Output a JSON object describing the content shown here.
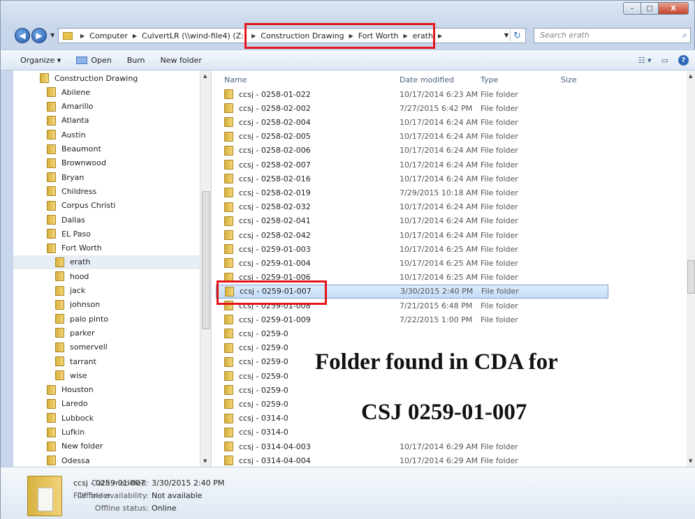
{
  "window": {
    "buttons": {
      "minimize": "–",
      "maximize": "□",
      "close": "X"
    }
  },
  "address": {
    "crumbs": [
      "Computer",
      "CulvertLR (\\\\wind-file4) (Z:)",
      "Construction Drawing",
      "Fort Worth",
      "erath"
    ],
    "search_placeholder": "Search erath"
  },
  "toolbar": {
    "organize": "Organize ▾",
    "open": "Open",
    "burn": "Burn",
    "new_folder": "New folder"
  },
  "nav": {
    "items": [
      {
        "label": "Construction Drawing",
        "level": 0
      },
      {
        "label": "Abilene",
        "level": 1
      },
      {
        "label": "Amarillo",
        "level": 1
      },
      {
        "label": "Atlanta",
        "level": 1
      },
      {
        "label": "Austin",
        "level": 1
      },
      {
        "label": "Beaumont",
        "level": 1
      },
      {
        "label": "Brownwood",
        "level": 1
      },
      {
        "label": "Bryan",
        "level": 1
      },
      {
        "label": "Childress",
        "level": 1
      },
      {
        "label": "Corpus Christi",
        "level": 1
      },
      {
        "label": "Dallas",
        "level": 1
      },
      {
        "label": "EL Paso",
        "level": 1
      },
      {
        "label": "Fort Worth",
        "level": 1
      },
      {
        "label": "erath",
        "level": 2,
        "selected": true
      },
      {
        "label": "hood",
        "level": 2
      },
      {
        "label": "jack",
        "level": 2
      },
      {
        "label": "johnson",
        "level": 2
      },
      {
        "label": "palo pinto",
        "level": 2
      },
      {
        "label": "parker",
        "level": 2
      },
      {
        "label": "somervell",
        "level": 2
      },
      {
        "label": "tarrant",
        "level": 2
      },
      {
        "label": "wise",
        "level": 2
      },
      {
        "label": "Houston",
        "level": 1
      },
      {
        "label": "Laredo",
        "level": 1
      },
      {
        "label": "Lubbock",
        "level": 1
      },
      {
        "label": "Lufkin",
        "level": 1
      },
      {
        "label": "New folder",
        "level": 1
      },
      {
        "label": "Odessa",
        "level": 1
      }
    ]
  },
  "files": {
    "columns": {
      "name": "Name",
      "date": "Date modified",
      "type": "Type",
      "size": "Size"
    },
    "rows": [
      {
        "name": "ccsj - 0258-01-022",
        "date": "10/17/2014 6:23 AM",
        "type": "File folder"
      },
      {
        "name": "ccsj - 0258-02-002",
        "date": "7/27/2015 6:42 PM",
        "type": "File folder"
      },
      {
        "name": "ccsj - 0258-02-004",
        "date": "10/17/2014 6:24 AM",
        "type": "File folder"
      },
      {
        "name": "ccsj - 0258-02-005",
        "date": "10/17/2014 6:24 AM",
        "type": "File folder"
      },
      {
        "name": "ccsj - 0258-02-006",
        "date": "10/17/2014 6:24 AM",
        "type": "File folder"
      },
      {
        "name": "ccsj - 0258-02-007",
        "date": "10/17/2014 6:24 AM",
        "type": "File folder"
      },
      {
        "name": "ccsj - 0258-02-016",
        "date": "10/17/2014 6:24 AM",
        "type": "File folder"
      },
      {
        "name": "ccsj - 0258-02-019",
        "date": "7/29/2015 10:18 AM",
        "type": "File folder"
      },
      {
        "name": "ccsj - 0258-02-032",
        "date": "10/17/2014 6:24 AM",
        "type": "File folder"
      },
      {
        "name": "ccsj - 0258-02-041",
        "date": "10/17/2014 6:24 AM",
        "type": "File folder"
      },
      {
        "name": "ccsj - 0258-02-042",
        "date": "10/17/2014 6:24 AM",
        "type": "File folder"
      },
      {
        "name": "ccsj - 0259-01-003",
        "date": "10/17/2014 6:25 AM",
        "type": "File folder"
      },
      {
        "name": "ccsj - 0259-01-004",
        "date": "10/17/2014 6:25 AM",
        "type": "File folder"
      },
      {
        "name": "ccsj - 0259-01-006",
        "date": "10/17/2014 6:25 AM",
        "type": "File folder"
      },
      {
        "name": "ccsj - 0259-01-007",
        "date": "3/30/2015 2:40 PM",
        "type": "File folder",
        "selected": true
      },
      {
        "name": "ccsj - 0259-01-008",
        "date": "7/21/2015 6:48 PM",
        "type": "File folder"
      },
      {
        "name": "ccsj - 0259-01-009",
        "date": "7/22/2015 1:00 PM",
        "type": "File folder"
      },
      {
        "name": "ccsj - 0259-0",
        "date": "",
        "type": ""
      },
      {
        "name": "ccsj - 0259-0",
        "date": "",
        "type": ""
      },
      {
        "name": "ccsj - 0259-0",
        "date": "",
        "type": ""
      },
      {
        "name": "ccsj - 0259-0",
        "date": "",
        "type": ""
      },
      {
        "name": "ccsj - 0259-0",
        "date": "",
        "type": ""
      },
      {
        "name": "ccsj - 0259-0",
        "date": "",
        "type": ""
      },
      {
        "name": "ccsj - 0314-0",
        "date": "",
        "type": ""
      },
      {
        "name": "ccsj - 0314-0",
        "date": "",
        "type": ""
      },
      {
        "name": "ccsj - 0314-04-003",
        "date": "10/17/2014 6:29 AM",
        "type": "File folder"
      },
      {
        "name": "ccsj - 0314-04-004",
        "date": "10/17/2014 6:29 AM",
        "type": "File folder"
      }
    ]
  },
  "annotation": {
    "line1": "Folder found in CDA for",
    "line2": "CSJ 0259-01-007",
    "highlight_color": "#e3151a"
  },
  "details": {
    "name": "ccsj - 0259-01-007",
    "type": "File folder",
    "date_label": "Date modified:",
    "date_value": "3/30/2015 2:40 PM",
    "offline_avail_label": "Offline availability:",
    "offline_avail_value": "Not available",
    "offline_status_label": "Offline status:",
    "offline_status_value": "Online"
  }
}
